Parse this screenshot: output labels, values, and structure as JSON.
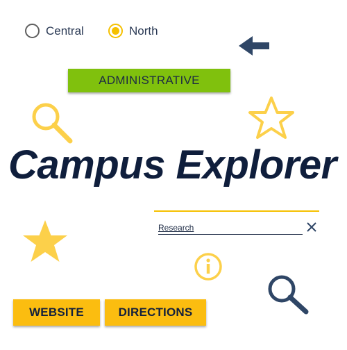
{
  "radios": [
    {
      "label": "Central",
      "checked": false
    },
    {
      "label": "North",
      "checked": true
    }
  ],
  "admin": {
    "label": "ADMINISTRATIVE"
  },
  "title": "Campus Explorer",
  "search": {
    "value": "Research"
  },
  "buttons": {
    "website": "WEBSITE",
    "directions": "DIRECTIONS"
  },
  "colors": {
    "accent_yellow": "#fbbd10",
    "admin_green": "#80c10d",
    "navy": "#0f1e3c",
    "icon_navy": "#2f4666",
    "icon_yellow": "#fcd04a"
  },
  "icons": [
    "back-arrow-icon",
    "search-icon",
    "star-outline-icon",
    "star-filled-icon",
    "info-icon",
    "clear-icon"
  ]
}
